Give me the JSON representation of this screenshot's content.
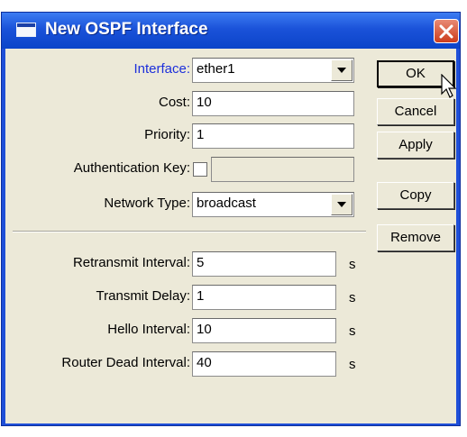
{
  "window": {
    "title": "New OSPF Interface",
    "icon": "window-icon",
    "close_icon": "close-icon"
  },
  "form": {
    "interface": {
      "label": "Interface:",
      "value": "ether1",
      "label_color": "#1c2fdb"
    },
    "cost": {
      "label": "Cost:",
      "value": "10"
    },
    "priority": {
      "label": "Priority:",
      "value": "1"
    },
    "auth_key": {
      "label": "Authentication Key:",
      "checked": false,
      "value": ""
    },
    "network_type": {
      "label": "Network Type:",
      "value": "broadcast"
    },
    "retransmit_interval": {
      "label": "Retransmit Interval:",
      "value": "5",
      "unit": "s"
    },
    "transmit_delay": {
      "label": "Transmit Delay:",
      "value": "1",
      "unit": "s"
    },
    "hello_interval": {
      "label": "Hello Interval:",
      "value": "10",
      "unit": "s"
    },
    "router_dead_interval": {
      "label": "Router Dead Interval:",
      "value": "40",
      "unit": "s"
    }
  },
  "buttons": {
    "ok": "OK",
    "cancel": "Cancel",
    "apply": "Apply",
    "copy": "Copy",
    "remove": "Remove"
  },
  "colors": {
    "title_bar": "#0b44c9",
    "dialog_bg": "#ece9d8",
    "accent_label": "#1c2fdb"
  }
}
